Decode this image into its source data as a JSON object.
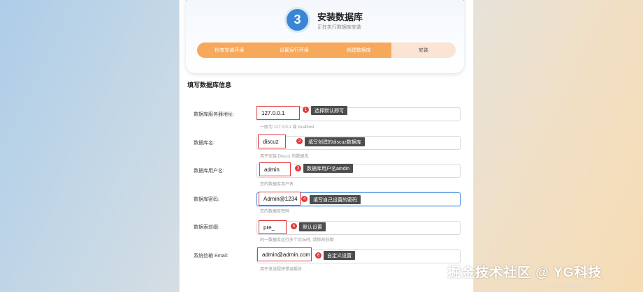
{
  "header": {
    "step_number": "3",
    "title": "安装数据库",
    "subtitle": "正在执行数据库安装"
  },
  "steps": [
    {
      "label": "检查安装环境"
    },
    {
      "label": "设置运行环境"
    },
    {
      "label": "创建数据库"
    },
    {
      "label": "安装"
    }
  ],
  "section_title": "填写数据库信息",
  "fields": [
    {
      "label": "数据库服务器地址:",
      "value": "127.0.0.1",
      "hint": "一般为 127.0.0.1 或 localhost",
      "badge": "1",
      "note": "选择默认即可"
    },
    {
      "label": "数据库名:",
      "value": "discuz",
      "hint": "用于安装 Discuz 的数据库",
      "badge": "2",
      "note": "填写创建的discuz数据库"
    },
    {
      "label": "数据库用户名:",
      "value": "admin",
      "hint": "您的数据库用户名",
      "badge": "3",
      "note": "数据库用户名amdin"
    },
    {
      "label": "数据库密码:",
      "value": "Admin@1234",
      "hint": "您的数据库密码",
      "badge": "4",
      "note": "填写自己设置的密码"
    },
    {
      "label": "数据表前缀:",
      "value": "pre_",
      "hint": "同一数据库运行多个论坛时, 请修改前缀",
      "badge": "5",
      "note": "默认设置"
    },
    {
      "label": "系统信箱 Email:",
      "value": "admin@admin.com",
      "hint": "用于发送程序错误报告",
      "badge": "6",
      "note": "自定义设置"
    }
  ],
  "watermark": {
    "main": "掘金技术社区 @ YG科技",
    "sub": "CSDN @鸿蒙小贝仔"
  }
}
